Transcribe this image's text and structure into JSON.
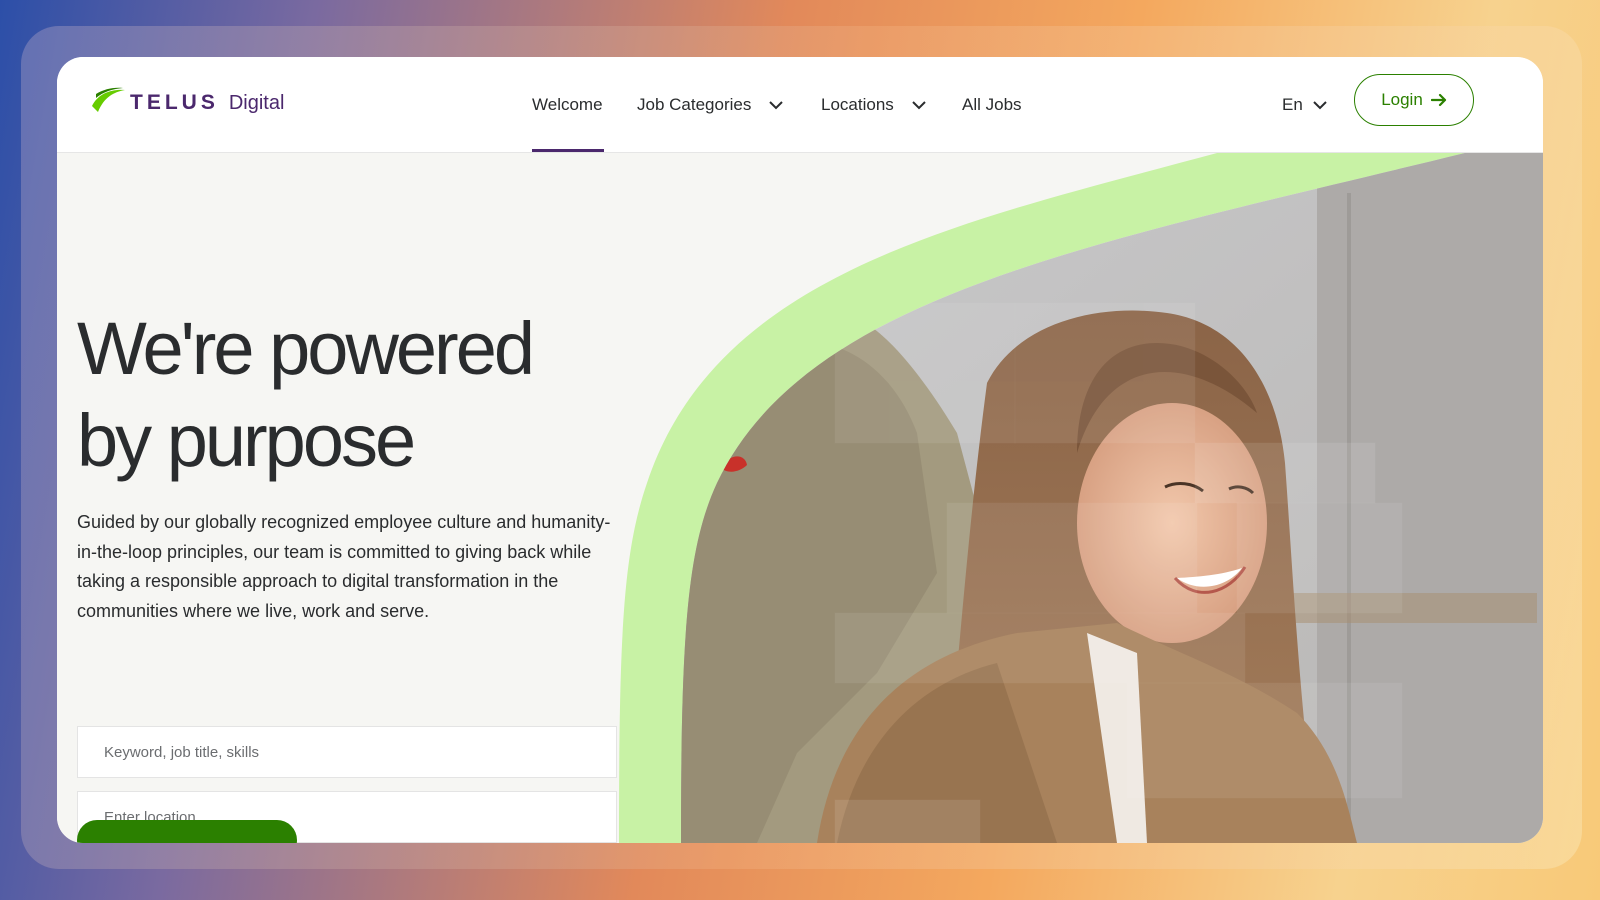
{
  "brand": {
    "logo_word": "TELUS",
    "logo_sub": "Digital",
    "primary_color": "#4b286d",
    "accent_color": "#2b8000",
    "highlight_color": "#c8f2a5"
  },
  "nav": {
    "items": [
      {
        "label": "Welcome",
        "active": true,
        "has_dropdown": false
      },
      {
        "label": "Job Categories",
        "active": false,
        "has_dropdown": true
      },
      {
        "label": "Locations",
        "active": false,
        "has_dropdown": true
      },
      {
        "label": "All Jobs",
        "active": false,
        "has_dropdown": false
      }
    ],
    "language": "En",
    "login_label": "Login"
  },
  "hero": {
    "headline_line1": "We're powered",
    "headline_line2": "by purpose",
    "intro": "Guided by our globally recognized employee culture and humanity-in-the-loop principles, our team is committed to giving back while taking a responsible approach to digital transformation in the communities where we live, work and serve.",
    "keyword_placeholder": "Keyword, job title, skills",
    "location_placeholder": "Enter location"
  },
  "icons": [
    "telus-leaf-icon",
    "chevron-down-icon",
    "arrow-right-icon"
  ]
}
